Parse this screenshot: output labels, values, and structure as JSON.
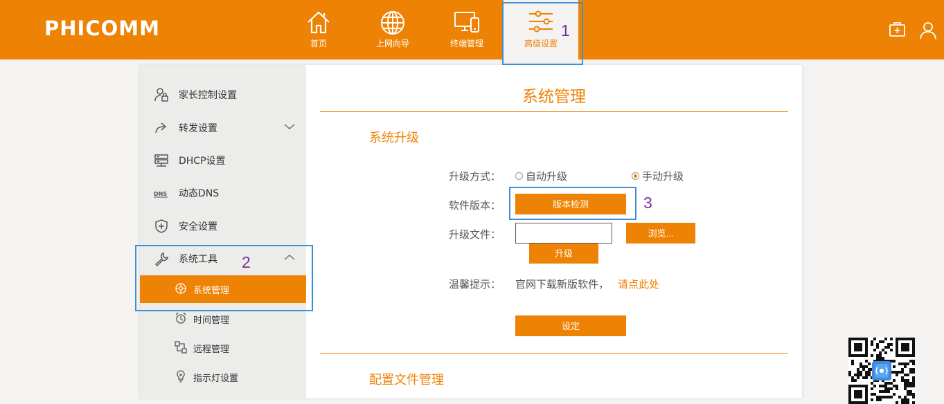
{
  "brand": {
    "logo": "PHICOMM",
    "accent_color": "#ee8204"
  },
  "topnav": {
    "items": [
      {
        "label": "首页",
        "icon": "home-icon"
      },
      {
        "label": "上网向导",
        "icon": "globe-icon"
      },
      {
        "label": "终端管理",
        "icon": "devices-icon"
      },
      {
        "label": "高级设置",
        "icon": "sliders-icon",
        "active": true
      }
    ],
    "right_icons": [
      "toolbox-icon",
      "user-icon"
    ]
  },
  "sidebar": {
    "items": [
      {
        "label": "家长控制设置",
        "icon": "parent-control-icon"
      },
      {
        "label": "转发设置",
        "icon": "forward-icon",
        "expandable": true
      },
      {
        "label": "DHCP设置",
        "icon": "server-icon"
      },
      {
        "label": "动态DNS",
        "icon": "dns-icon"
      },
      {
        "label": "安全设置",
        "icon": "shield-icon"
      },
      {
        "label": "系统工具",
        "icon": "wrench-icon",
        "expanded": true
      }
    ],
    "sub_items": [
      {
        "label": "系统管理",
        "icon": "system-gear-icon",
        "active": true
      },
      {
        "label": "时间管理",
        "icon": "alarm-clock-icon"
      },
      {
        "label": "远程管理",
        "icon": "remote-icon"
      },
      {
        "label": "指示灯设置",
        "icon": "bulb-icon"
      }
    ]
  },
  "main": {
    "title": "系统管理",
    "upgrade": {
      "section_title": "系统升级",
      "mode_label": "升级方式：",
      "mode_options": [
        "自动升级",
        "手动升级"
      ],
      "mode_selected": "手动升级",
      "version_label": "软件版本：",
      "check_button": "版本检测",
      "file_label": "升级文件：",
      "file_value": "",
      "browse_button": "浏览...",
      "upgrade_button": "升级",
      "tip_label": "温馨提示：",
      "tip_text": "官网下载新版软件，",
      "tip_link": "请点此处",
      "set_button": "设定"
    },
    "config": {
      "section_title": "配置文件管理"
    }
  },
  "annotations": [
    "1",
    "2",
    "3"
  ]
}
